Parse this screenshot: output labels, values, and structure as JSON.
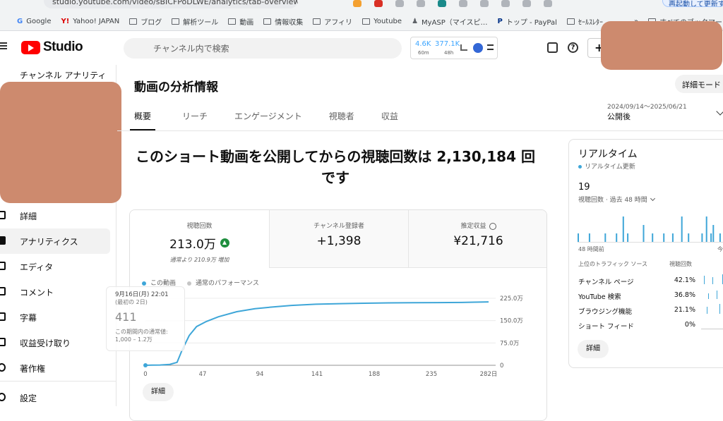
{
  "browser": {
    "url": "studio.youtube.com/video/sBICFPoDLWE/analytics/tab-overview/...",
    "update_label": "再起動して更新する",
    "bookmarks": [
      "Google",
      "Yahoo! JAPAN",
      "ブログ",
      "解析ツール",
      "動画",
      "情報収集",
      "アフィリ",
      "Youtube",
      "MyASP（マイスピ…",
      "トップ - PayPal",
      "ｾｰﾙｽﾚﾀｰ"
    ],
    "other_bookmarks": "すべてのブックマーク"
  },
  "header": {
    "logo_text": "Studio",
    "search_placeholder": "チャンネル内で検索",
    "stats": {
      "value1": "4.6K",
      "label1": "60m",
      "value2": "377.1K",
      "label2": "48h"
    }
  },
  "sidebar": {
    "title": "チャンネル アナリティ",
    "items": [
      {
        "label": "詳細",
        "icon": "pencil-icon"
      },
      {
        "label": "アナリティクス",
        "icon": "analytics-icon"
      },
      {
        "label": "エディタ",
        "icon": "editor-icon"
      },
      {
        "label": "コメント",
        "icon": "comment-icon"
      },
      {
        "label": "字幕",
        "icon": "subtitles-icon"
      },
      {
        "label": "収益受け取り",
        "icon": "monetization-icon"
      },
      {
        "label": "著作権",
        "icon": "copyright-icon"
      },
      {
        "label": "設定",
        "icon": "settings-icon"
      }
    ]
  },
  "main": {
    "title": "動画の分析情報",
    "detail_mode": "詳細モード",
    "tabs": [
      "概要",
      "リーチ",
      "エンゲージメント",
      "視聴者",
      "収益"
    ],
    "date_range": "2024/09/14〜2025/06/21",
    "date_label": "公開後",
    "headline_line1": "このショート動画を公開してからの視聴回数は 2,130,184 回",
    "headline_line2": "です"
  },
  "metrics": [
    {
      "label": "視聴回数",
      "value": "213.0万",
      "sub": "通常より 210.9万 増加"
    },
    {
      "label": "チャンネル登録者",
      "value": "+1,398"
    },
    {
      "label": "推定収益",
      "value": "¥21,716"
    }
  ],
  "legend": {
    "series1": "この動画",
    "series2": "通常のパフォーマンス"
  },
  "tooltip": {
    "date": "9月16日(月) 22:01",
    "note": "(最初の 2日)",
    "value": "411",
    "range_label": "この期間内の通常値:",
    "range": "1,000 – 1.2万"
  },
  "chart_data": {
    "type": "line",
    "x_ticks": [
      "0",
      "47",
      "94",
      "141",
      "188",
      "235",
      "282日"
    ],
    "y_ticks": [
      "225.0万",
      "150.0万",
      "75.0万",
      "0"
    ],
    "xlim": [
      0,
      282
    ],
    "ylim": [
      0,
      225
    ],
    "series": [
      {
        "name": "この動画",
        "x": [
          0,
          5,
          12,
          20,
          26,
          30,
          36,
          42,
          50,
          60,
          75,
          90,
          105,
          120,
          140,
          160,
          180,
          200,
          220,
          240,
          260,
          270,
          282
        ],
        "values": [
          0,
          0.4,
          1,
          3,
          10,
          50,
          100,
          130,
          147,
          163,
          180,
          190,
          196,
          201,
          205,
          207,
          208.5,
          209.5,
          210,
          210.5,
          211,
          212,
          213
        ]
      }
    ],
    "colors": {
      "series1": "#3ea6d8",
      "series2": "#c6c6c6"
    }
  },
  "chart_detail": "詳細",
  "realtime": {
    "title": "リアルタイム",
    "subtitle": "リアルタイム更新",
    "count": "19",
    "count_label": "視聴回数 · 過去 48 時間",
    "left_label": "48 時間前",
    "right_label": "今",
    "bars": [
      1,
      0,
      0,
      0,
      0,
      1,
      0,
      0,
      0,
      0,
      0,
      0,
      1,
      0,
      0,
      0,
      0,
      1,
      0,
      0,
      3,
      0,
      1,
      0,
      0,
      0,
      0,
      0,
      0,
      2,
      0,
      0,
      0,
      1,
      0,
      0,
      0,
      0,
      1,
      0,
      0,
      0,
      1,
      0,
      0,
      0,
      3,
      0,
      0,
      1,
      0,
      0,
      0,
      0,
      0,
      1,
      0,
      3,
      0,
      1,
      2,
      0,
      0,
      1,
      0,
      0,
      2,
      0,
      1
    ],
    "sources_header": "上位のトラフィック ソース",
    "sources_header_right": "視聴回数",
    "sources": [
      {
        "name": "チャンネル ページ",
        "pct": "42.1%"
      },
      {
        "name": "YouTube 検索",
        "pct": "36.8%"
      },
      {
        "name": "ブラウジング機能",
        "pct": "21.1%"
      },
      {
        "name": "ショート フィード",
        "pct": "0%"
      }
    ],
    "detail": "詳細"
  }
}
